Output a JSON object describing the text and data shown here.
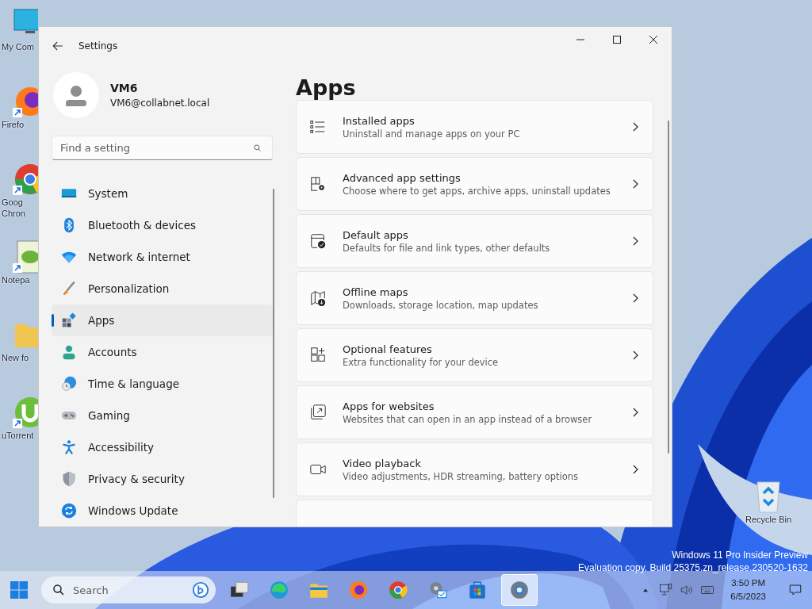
{
  "desktop_icons": [
    {
      "label": "My Com",
      "kind": "computer"
    },
    {
      "label": "Firefo",
      "kind": "firefox",
      "shortcut": true
    },
    {
      "label": "Goog\nChron",
      "kind": "chrome",
      "shortcut": true
    },
    {
      "label": "Notepa",
      "kind": "notepad",
      "shortcut": true
    },
    {
      "label": "New fo",
      "kind": "folder",
      "shortcut": false
    },
    {
      "label": "uTorrent",
      "kind": "utorrent",
      "shortcut": true
    }
  ],
  "recycle_bin": {
    "label": "Recycle Bin"
  },
  "evaluation_notice": {
    "line_1": "Windows 11 Pro Insider Preview",
    "line_2": "Evaluation copy. Build 25375.zn_release.230520-1632"
  },
  "window": {
    "title": "Settings"
  },
  "profile": {
    "name": "VM6",
    "email": "VM6@collabnet.local"
  },
  "search": {
    "placeholder": "Find a setting"
  },
  "sidebar": {
    "items": [
      {
        "label": "System",
        "kind": "system",
        "selected": false
      },
      {
        "label": "Bluetooth & devices",
        "kind": "bluetooth",
        "selected": false
      },
      {
        "label": "Network & internet",
        "kind": "network",
        "selected": false
      },
      {
        "label": "Personalization",
        "kind": "brush",
        "selected": false
      },
      {
        "label": "Apps",
        "kind": "apps",
        "selected": true
      },
      {
        "label": "Accounts",
        "kind": "accounts",
        "selected": false
      },
      {
        "label": "Time & language",
        "kind": "time",
        "selected": false
      },
      {
        "label": "Gaming",
        "kind": "gaming",
        "selected": false
      },
      {
        "label": "Accessibility",
        "kind": "accessibility",
        "selected": false
      },
      {
        "label": "Privacy & security",
        "kind": "shield",
        "selected": false
      },
      {
        "label": "Windows Update",
        "kind": "update",
        "selected": false
      }
    ]
  },
  "page": {
    "title": "Apps",
    "items": [
      {
        "title": "Installed apps",
        "description": "Uninstall and manage apps on your PC",
        "kind": "list"
      },
      {
        "title": "Advanced app settings",
        "description": "Choose where to get apps, archive apps, uninstall updates",
        "kind": "advanced"
      },
      {
        "title": "Default apps",
        "description": "Defaults for file and link types, other defaults",
        "kind": "default"
      },
      {
        "title": "Offline maps",
        "description": "Downloads, storage location, map updates",
        "kind": "map"
      },
      {
        "title": "Optional features",
        "description": "Extra functionality for your device",
        "kind": "features"
      },
      {
        "title": "Apps for websites",
        "description": "Websites that can open in an app instead of a browser",
        "kind": "websites"
      },
      {
        "title": "Video playback",
        "description": "Video adjustments, HDR streaming, battery options",
        "kind": "video"
      }
    ]
  },
  "taskbar": {
    "search_placeholder": "Search",
    "apps": [
      {
        "kind": "taskview",
        "active": false
      },
      {
        "kind": "edge",
        "active": false
      },
      {
        "kind": "explorer",
        "active": false
      },
      {
        "kind": "firefox",
        "active": false
      },
      {
        "kind": "chrome",
        "active": false
      },
      {
        "kind": "admin",
        "active": false
      },
      {
        "kind": "store",
        "active": false
      },
      {
        "kind": "settings",
        "active": true
      }
    ],
    "time": "3:50 PM",
    "date": "6/5/2023"
  }
}
